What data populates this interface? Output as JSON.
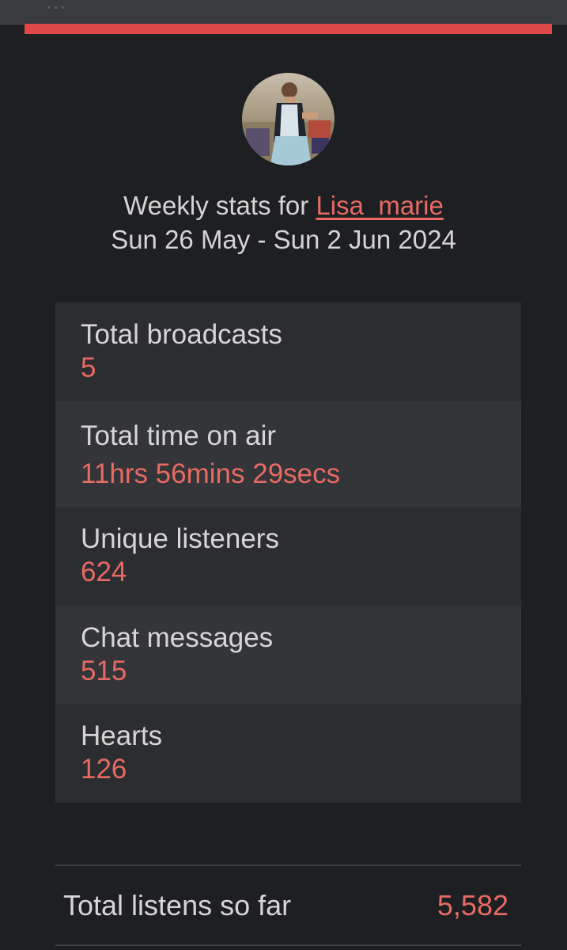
{
  "header": {
    "clipped_title": "...",
    "accent_color": "#e04848"
  },
  "profile": {
    "avatar_icon": "user-photo",
    "heading_prefix": "Weekly stats for",
    "username": "Lisa_marie",
    "date_range": "Sun 26 May - Sun 2 Jun 2024"
  },
  "stats": [
    {
      "label": "Total broadcasts",
      "value": "5"
    },
    {
      "label": "Total time on air",
      "value": "11hrs 56mins 29secs"
    },
    {
      "label": "Unique listeners",
      "value": "624"
    },
    {
      "label": "Chat messages",
      "value": "515"
    },
    {
      "label": "Hearts",
      "value": "126"
    }
  ],
  "totals": {
    "label": "Total listens so far",
    "value": "5,582",
    "value_color": "#e76a63"
  }
}
